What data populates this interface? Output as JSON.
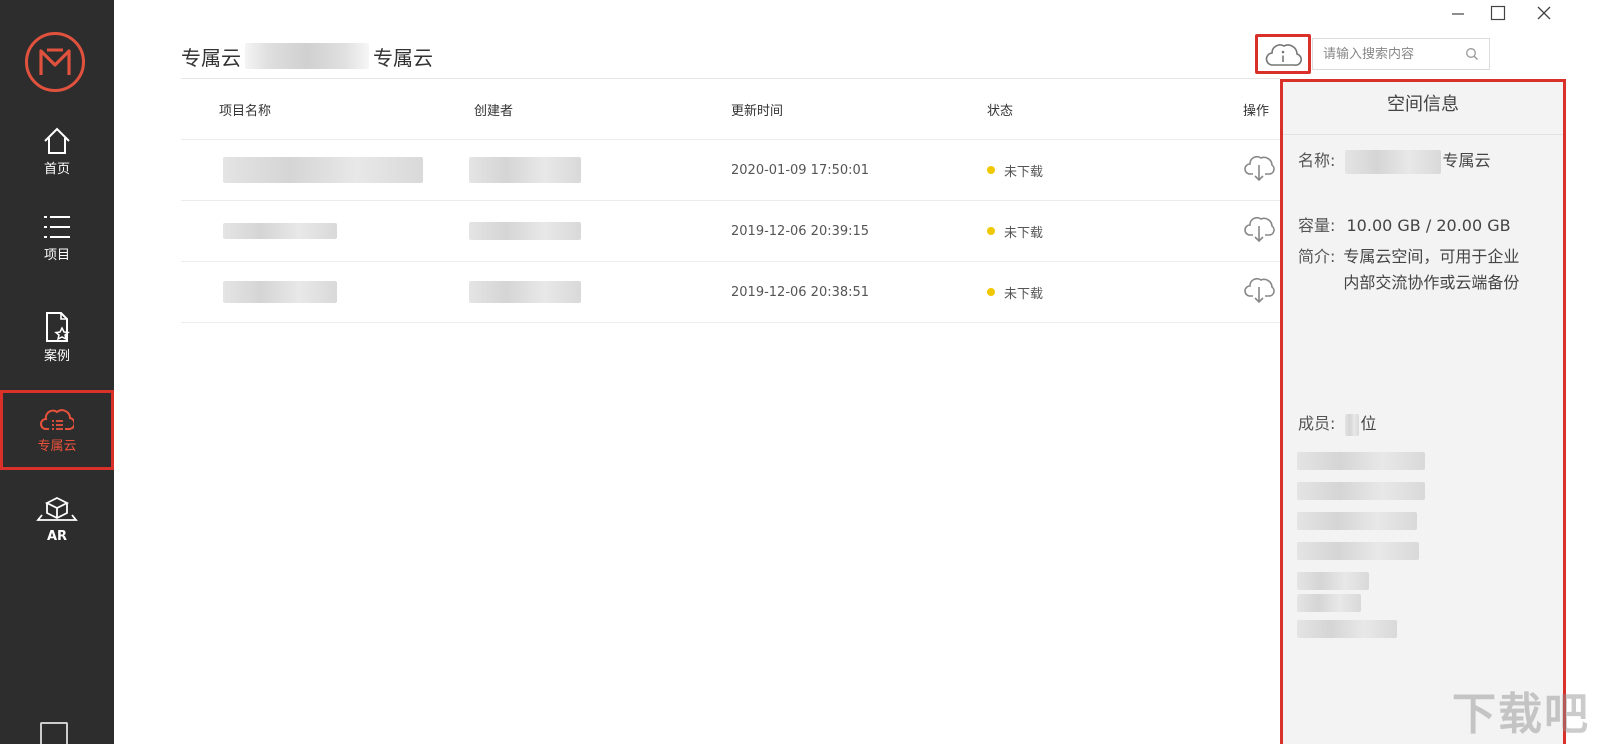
{
  "window": {
    "minimize_icon": "minimize-icon",
    "maximize_icon": "maximize-icon",
    "close_icon": "close-icon"
  },
  "sidebar": {
    "items": [
      {
        "label": "首页",
        "icon": "home-icon"
      },
      {
        "label": "项目",
        "icon": "list-icon"
      },
      {
        "label": "案例",
        "icon": "case-doc-star-icon"
      },
      {
        "label": "专属云",
        "icon": "cloud-list-icon",
        "active": true
      },
      {
        "label": "AR",
        "icon": "ar-cube-icon"
      }
    ],
    "accent_color": "#e8523b"
  },
  "breadcrumb": {
    "root": "专属云",
    "current": "专属云"
  },
  "search": {
    "placeholder": "请输入搜索内容"
  },
  "table": {
    "headers": {
      "name": "项目名称",
      "creator": "创建者",
      "updated": "更新时间",
      "status": "状态",
      "actions": "操作"
    },
    "rows": [
      {
        "updated": "2020-01-09 17:50:01",
        "status": "未下载"
      },
      {
        "updated": "2019-12-06 20:39:15",
        "status": "未下载"
      },
      {
        "updated": "2019-12-06 20:38:51",
        "status": "未下载"
      }
    ],
    "status_color": "#f0c800"
  },
  "panel": {
    "title": "空间信息",
    "name_label": "名称:",
    "name_value_suffix": "专属云",
    "capacity_label": "容量:",
    "capacity_value": "10.00 GB / 20.00 GB",
    "intro_label": "简介:",
    "intro_value": "专属云空间，可用于企业内部交流协作或云端备份",
    "members_label": "成员:",
    "members_suffix": "位",
    "border_color": "#d9302a"
  },
  "watermark": "下载吧"
}
